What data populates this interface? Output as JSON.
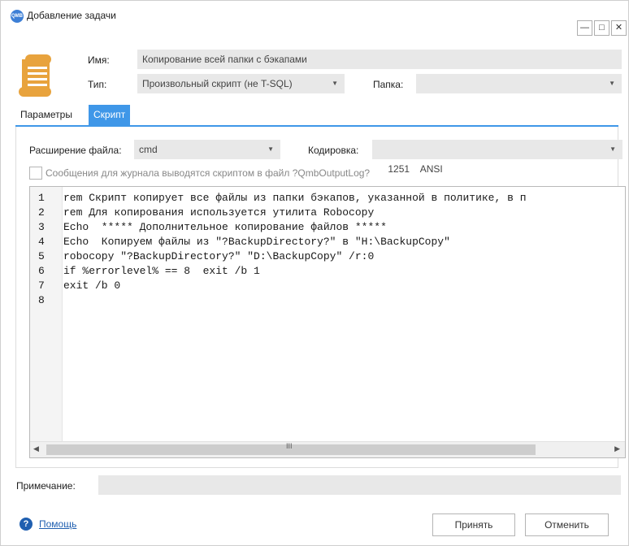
{
  "window": {
    "app_icon_text": "QMB",
    "title": "Добавление задачи",
    "minimize_glyph": "—",
    "maximize_glyph": "□",
    "close_glyph": "✕"
  },
  "header": {
    "name_label": "Имя:",
    "name_value": "Копирование всей папки с бэкапами",
    "type_label": "Тип:",
    "type_value": "Произвольный скрипт (не T-SQL)",
    "folder_label": "Папка:",
    "folder_value": "",
    "dropdown_glyph": "▼"
  },
  "tabs": [
    {
      "label": "Параметры",
      "active": false
    },
    {
      "label": "Скрипт",
      "active": true
    }
  ],
  "script": {
    "extension_label": "Расширение файла:",
    "extension_value": "cmd",
    "encoding_label": "Кодировка:",
    "encoding_value": "1251    ANSI",
    "log_checkbox_label": "Сообщения для журнала выводятся скриптом в файл ?QmbOutputLog?",
    "log_checkbox_checked": false
  },
  "editor": {
    "lines": [
      {
        "num": "1",
        "text": "rem Скрипт копирует все файлы из папки бэкапов, указанной в политике, в п"
      },
      {
        "num": "2",
        "text": "rem Для копирования используется утилита Robocopy"
      },
      {
        "num": "3",
        "text": "Echo  ***** Дополнительное копирование файлов *****"
      },
      {
        "num": "4",
        "text": "Echo  Копируем файлы из \"?BackupDirectory?\" в \"H:\\BackupCopy\""
      },
      {
        "num": "5",
        "text": "robocopy \"?BackupDirectory?\" \"D:\\BackupCopy\" /r:0"
      },
      {
        "num": "6",
        "text": "if %errorlevel% == 8  exit /b 1"
      },
      {
        "num": "7",
        "text": "exit /b 0"
      },
      {
        "num": "8",
        "text": ""
      }
    ],
    "scroll_left_glyph": "◀",
    "scroll_right_glyph": "▶",
    "scroll_grip": "III"
  },
  "footer": {
    "note_label": "Примечание:",
    "note_value": "",
    "help_glyph": "?",
    "help_label": "Помощь",
    "accept_label": "Принять",
    "cancel_label": "Отменить"
  },
  "colors": {
    "accent": "#3f97e8",
    "field_bg": "#e8e8e8",
    "link": "#1f5fb0",
    "doc_icon": "#e8a33d"
  },
  "icons": [
    "app-logo-icon",
    "document-scroll-icon",
    "chevron-down-icon",
    "help-icon"
  ]
}
